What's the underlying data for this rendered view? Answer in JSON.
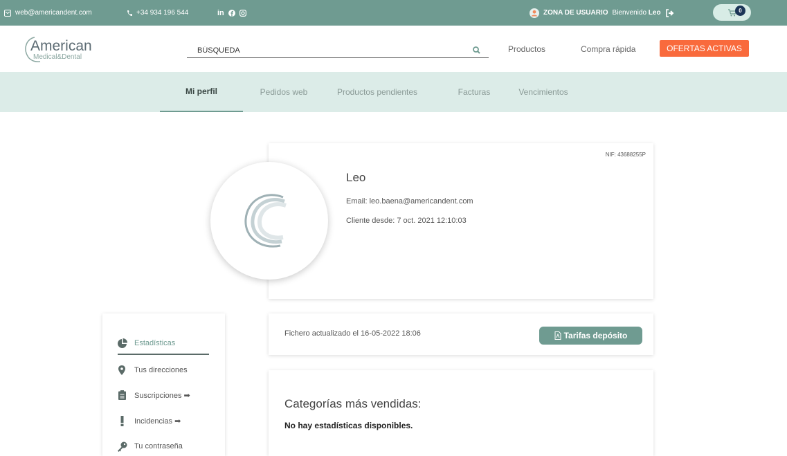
{
  "topbar": {
    "email": "web@americandent.com",
    "phone": "+34 934 196 544",
    "zona": "ZONA DE USUARIO",
    "welcome_prefix": "Bienvenido",
    "user": "Leo",
    "cart_count": "0",
    "bg_color": "#6f9b91"
  },
  "header": {
    "logo_main": "American",
    "logo_sub": "Medical&Dental",
    "search_placeholder": "BÚSQUEDA",
    "nav_productos": "Productos",
    "nav_compra": "Compra rápida",
    "ofertas": "OFERTAS ACTIVAS",
    "ofertas_color": "#f96a3c"
  },
  "tabs": [
    {
      "label": "Mi perfil",
      "active": true
    },
    {
      "label": "Pedidos web"
    },
    {
      "label": "Productos pendientes"
    },
    {
      "label": "Facturas"
    },
    {
      "label": "Vencimientos"
    }
  ],
  "profile": {
    "nif": "NIF: 43688255P",
    "name": "Leo",
    "email": "Email: leo.baena@americandent.com",
    "desde": "Cliente desde: 7 oct. 2021 12:10:03"
  },
  "file": {
    "text": "Fichero actualizado el 16-05-2022 18:06",
    "button": "Tarifas depósito"
  },
  "stats": {
    "title": "Categorías más vendidas:",
    "empty": "No hay estadísticas disponibles."
  },
  "menu": [
    {
      "label": "Estadísticas",
      "icon": "pie-chart-icon"
    },
    {
      "label": "Tus direcciones",
      "icon": "map-marker-icon"
    },
    {
      "label": "Suscripciones ➡",
      "icon": "clipboard-icon"
    },
    {
      "label": "Incidencias ➡",
      "icon": "exclamation-icon"
    },
    {
      "label": "Tu contraseña",
      "icon": "key-icon"
    }
  ]
}
